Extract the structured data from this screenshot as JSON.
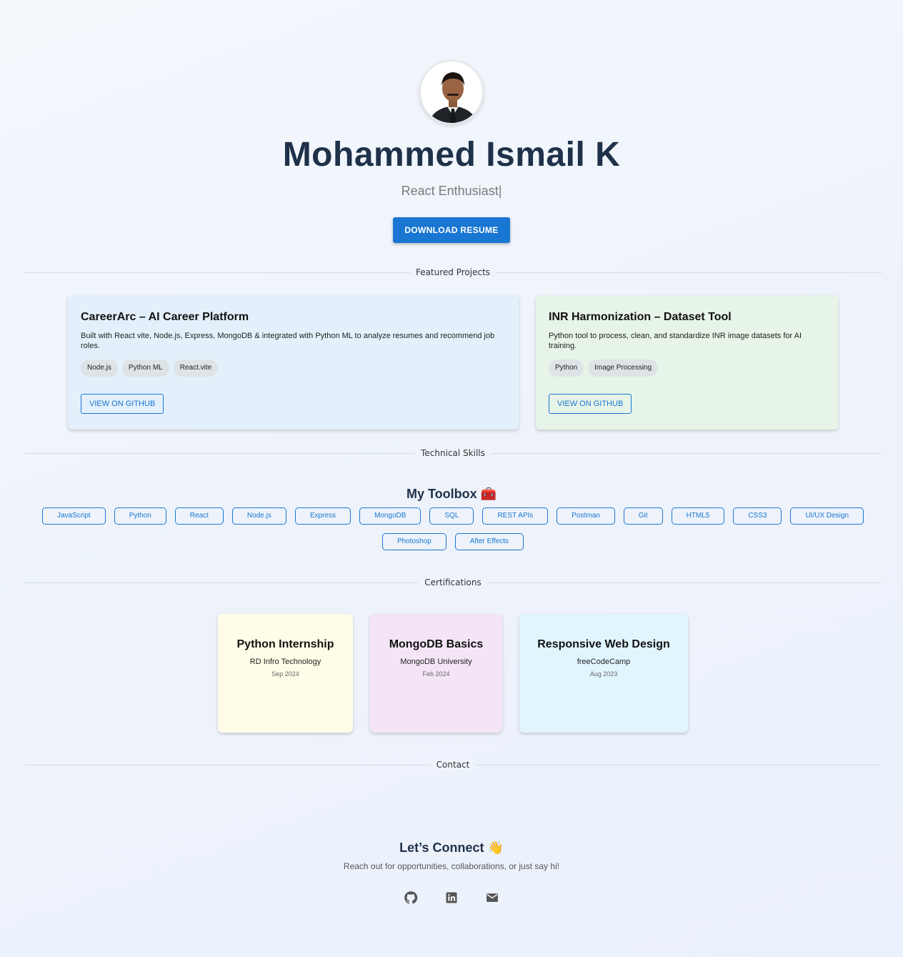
{
  "profile": {
    "name": "Mohammed Ismail K",
    "tagline": "React Enthusiast|",
    "resume_button": "DOWNLOAD RESUME"
  },
  "sections": {
    "projects": "Featured Projects",
    "skills": "Technical Skills",
    "certifications": "Certifications",
    "contact": "Contact"
  },
  "projects": [
    {
      "title": "CareerArc – AI Career Platform",
      "description": "Built with React vite, Node.js, Express, MongoDB & integrated with Python ML to analyze resumes and recommend job roles.",
      "tags": [
        "Node.js",
        "Python ML",
        "React.vite"
      ],
      "button": "VIEW ON GITHUB",
      "color": "#e3f0fb"
    },
    {
      "title": "INR Harmonization – Dataset Tool",
      "description": "Python tool to process, clean, and standardize INR image datasets for AI training.",
      "tags": [
        "Python",
        "Image Processing"
      ],
      "button": "VIEW ON GITHUB",
      "color": "#e7f4e8"
    }
  ],
  "toolbox": {
    "title": "My Toolbox 🧰",
    "skills": [
      "JavaScript",
      "Python",
      "React",
      "Node.js",
      "Express",
      "MongoDB",
      "SQL",
      "REST APIs",
      "Postman",
      "Git",
      "HTML5",
      "CSS3",
      "UI/UX Design",
      "Photoshop",
      "After Effects"
    ]
  },
  "certifications": [
    {
      "title": "Python Internship",
      "org": "RD Infro Technology",
      "date": "Sep 2024",
      "color": "#fffde8"
    },
    {
      "title": "MongoDB Basics",
      "org": "MongoDB University",
      "date": "Feb 2024",
      "color": "#f3e5f5"
    },
    {
      "title": "Responsive Web Design",
      "org": "freeCodeCamp",
      "date": "Aug 2023",
      "color": "#e1f5fe"
    }
  ],
  "connect": {
    "title": "Let’s Connect 👋",
    "subtitle": "Reach out for opportunities, collaborations, or just say hi!",
    "icons": [
      "github-icon",
      "linkedin-icon",
      "mail-icon"
    ]
  },
  "colors": {
    "accent": "#1976d2",
    "heading": "#1e3148"
  }
}
